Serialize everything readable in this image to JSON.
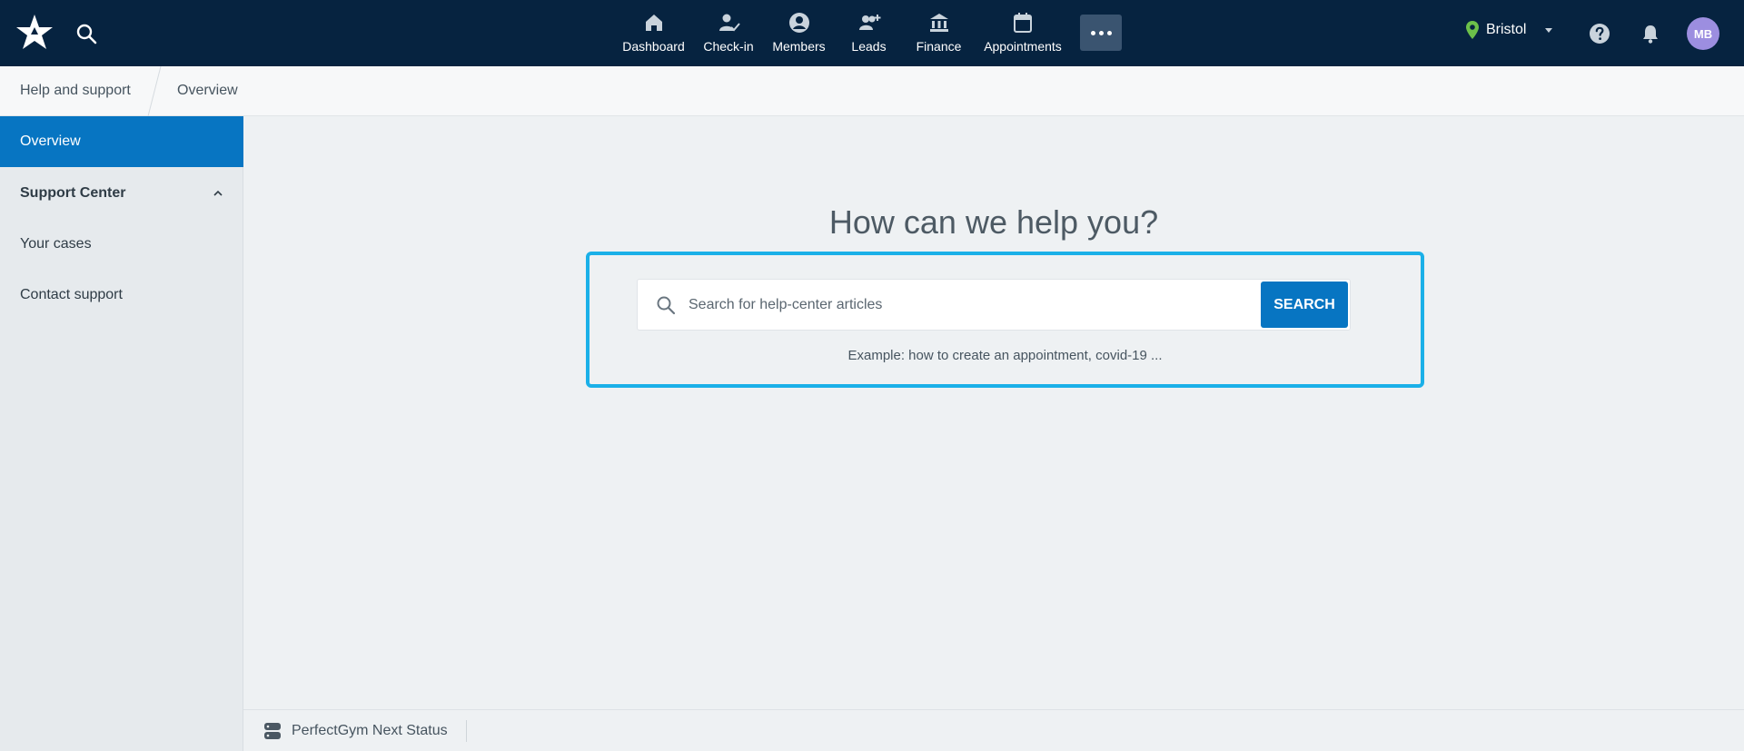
{
  "topbar": {
    "logo_icon": "star-logo-icon",
    "search_icon": "search-icon",
    "nav": [
      {
        "label": "Dashboard",
        "icon": "home-icon"
      },
      {
        "label": "Check-in",
        "icon": "user-check-icon"
      },
      {
        "label": "Members",
        "icon": "user-circle-icon"
      },
      {
        "label": "Leads",
        "icon": "user-plus-icon"
      },
      {
        "label": "Finance",
        "icon": "bank-icon"
      },
      {
        "label": "Appointments",
        "icon": "calendar-icon"
      }
    ],
    "more_icon": "more-dots-icon",
    "location": "Bristol",
    "avatar_initials": "MB",
    "avatar_color": "#9c8ee0",
    "bg_color": "#062340"
  },
  "breadcrumb": {
    "items": [
      "Help and support",
      "Overview"
    ]
  },
  "sidebar": {
    "items": [
      {
        "label": "Overview",
        "active": true
      },
      {
        "label": "Support Center",
        "group": true,
        "expanded": true
      },
      {
        "label": "Your cases"
      },
      {
        "label": "Contact support"
      }
    ],
    "accent_color": "#0775c2"
  },
  "main": {
    "title": "How can we help you?",
    "search": {
      "placeholder": "Search for help-center articles",
      "value": "",
      "button_label": "SEARCH"
    },
    "example_text": "Example: how to create an appointment, covid-19 ...",
    "highlight_color": "#1ab0e8"
  },
  "footer": {
    "status_label": "PerfectGym Next Status",
    "status_icon": "server-status-icon"
  }
}
